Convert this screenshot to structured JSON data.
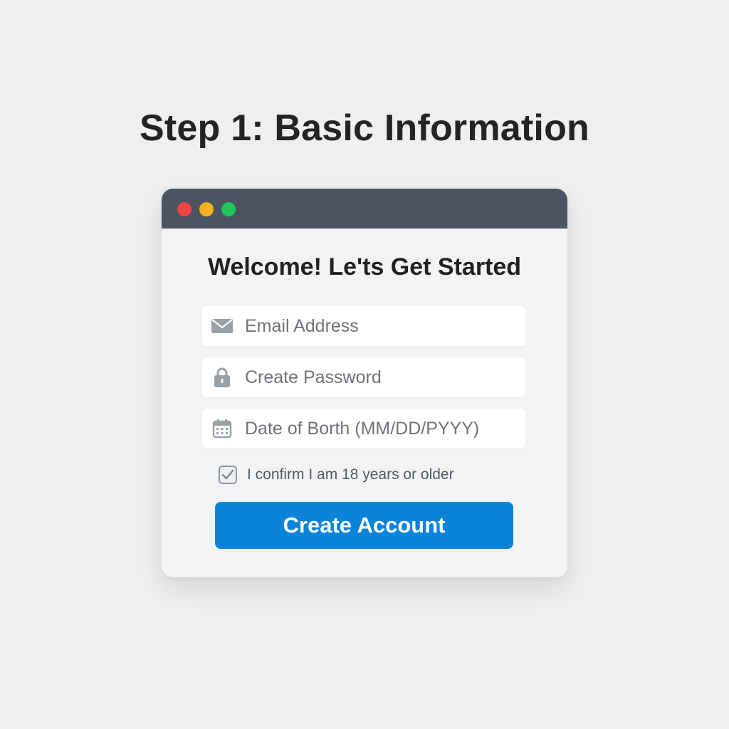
{
  "step_title": "Step 1: Basic Information",
  "window": {
    "controls": [
      {
        "name": "close",
        "color": "#ef4444"
      },
      {
        "name": "minimize",
        "color": "#f5b321"
      },
      {
        "name": "maximize",
        "color": "#22c55e"
      }
    ]
  },
  "form": {
    "heading": "Welcome! Le'ts Get Started",
    "fields": {
      "email": {
        "placeholder": "Email Address",
        "icon": "envelope-icon"
      },
      "password": {
        "placeholder": "Create Password",
        "icon": "lock-icon"
      },
      "dob": {
        "placeholder": "Date of Borth (MM/DD/PYYY)",
        "icon": "calendar-icon"
      }
    },
    "age_confirm": {
      "label": "I confirm I am 18 years or older",
      "checked": true
    },
    "submit": {
      "label": "Create Account",
      "color": "#0a84d8"
    }
  },
  "colors": {
    "page_background": "#efeff0",
    "titlebar": "#4a5462",
    "icon_gray": "#9aa0a6"
  }
}
